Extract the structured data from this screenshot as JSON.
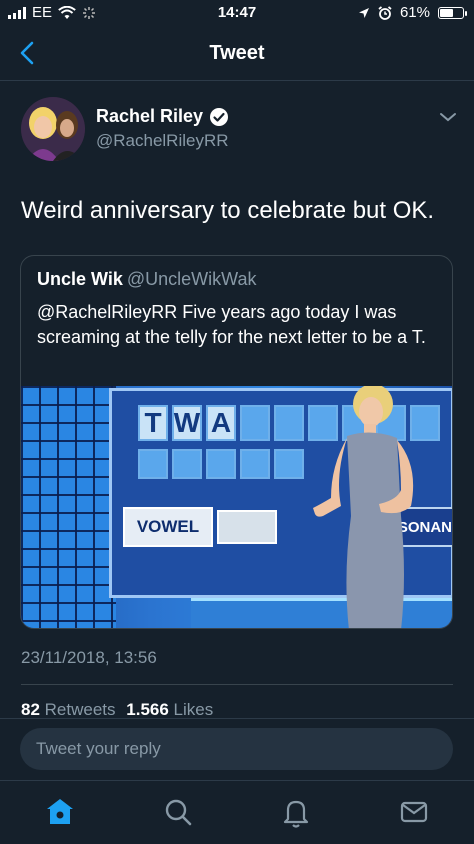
{
  "status_bar": {
    "carrier": "EE",
    "time": "14:47",
    "battery": "61%",
    "battery_level": 0.61
  },
  "nav": {
    "title": "Tweet",
    "back_icon": "chevron-left-icon"
  },
  "tweet": {
    "author_name": "Rachel Riley",
    "author_handle": "@RachelRileyRR",
    "verified_icon": "verified-badge-icon",
    "text": "Weird anniversary to celebrate but OK.",
    "timestamp": "23/11/2018, 13:56",
    "retweets_count": "82",
    "retweets_label": "Retweets",
    "likes_count": "1.566",
    "likes_label": "Likes"
  },
  "quoted_tweet": {
    "author_name": "Uncle Wik",
    "author_handle": "@UncleWikWak",
    "text": "@RachelRileyRR Five years ago today I was screaming at the telly for the next letter to be a T.",
    "image": {
      "tiles": [
        "T",
        "W",
        "A"
      ],
      "vowel_label": "VOWEL",
      "consonant_label": "NSONANT"
    }
  },
  "reply": {
    "placeholder": "Tweet your reply"
  },
  "tab_bar": {
    "items": [
      "home-icon",
      "search-icon",
      "notifications-icon",
      "messages-icon"
    ],
    "active_color": "#1da1f2"
  },
  "colors": {
    "background": "#15202b",
    "secondary_text": "#8899a6",
    "accent": "#1da1f2"
  }
}
